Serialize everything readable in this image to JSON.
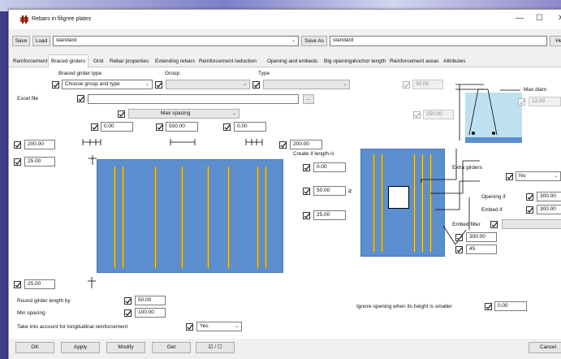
{
  "window": {
    "title": "Rebars in filigree plates",
    "minimize": "—",
    "maximize": "☐",
    "close": "✕"
  },
  "toolbar": {
    "save": "Save",
    "load": "Load",
    "preset_value": "standard",
    "save_as": "Save As",
    "save_as_value": "standard",
    "help": "Help"
  },
  "tabs": [
    "Reinforcement",
    "Braced girders",
    "Grid",
    "Rebar properties",
    "Extending rebars",
    "Reinforcement reduction",
    "Opening and embeds",
    "Big openings",
    "Anchor length",
    "Reinforcement areas",
    "Attributes"
  ],
  "active_tab": 1,
  "braced": {
    "girder_type_label": "Braced girder type",
    "group_label": "Group",
    "type_label": "Type",
    "girder_type_value": "Choose group and type",
    "group_value": "",
    "type_value": "",
    "excel_label": "Excel file",
    "excel_value": "",
    "browse": "...",
    "spacing_mode": "Max spacing",
    "spacing_a": "0.00",
    "spacing_b": "500.00",
    "spacing_c": "0.00",
    "left_offset": "200.00",
    "right_offset": "200.00",
    "top_offset": "25.00",
    "bottom_offset": "25.00",
    "round_label": "Round girder length by",
    "round_value": "50.00",
    "min_spacing_label": "Min spacing",
    "min_spacing_value": "100.00",
    "longitudinal_label": "Take into account for longitudinal reinforcement",
    "longitudinal_value": "Yes"
  },
  "profile": {
    "height_value": "30.00",
    "length_value": "250.00",
    "max_diam_label": "Max diam",
    "max_diam_value": "12.00"
  },
  "opening": {
    "create_label": "Create if length is",
    "create_value": "0.00",
    "gap_value": "50.00",
    "gap_operator": "≥",
    "offset_value": "25.00",
    "extra_label": "Extra girders",
    "extra_value": "No",
    "opening_if_label": "Opening if",
    "opening_if_value": "300.00",
    "embed_if_label": "Embed if",
    "embed_if_value": "300.00",
    "embed_filter_label": "Embed filter",
    "embed_filter_value": "",
    "edge_value": "300.00",
    "angle_value": "45",
    "ignore_label": "Ignore opening when its height is smaller",
    "ignore_value": "0.00"
  },
  "footer": {
    "ok": "OK",
    "apply": "Apply",
    "modify": "Modify",
    "get": "Get",
    "toggle": "☑ / ☐",
    "cancel": "Cancel"
  },
  "colors": {
    "plate": "#5b8fd0",
    "rebar": "#f3d24a",
    "accent": "#cc3d2a"
  }
}
